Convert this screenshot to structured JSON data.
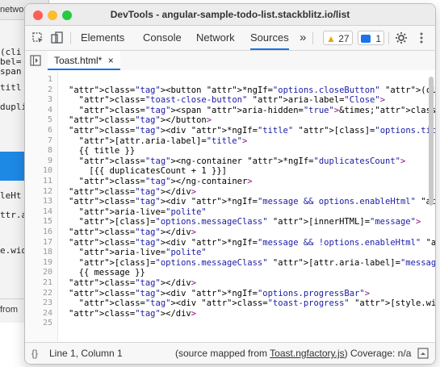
{
  "background_window": {
    "topbar_text": "network",
    "lines": [
      "(cli",
      "bel=",
      "span",
      "titl",
      "dupli",
      "leHt",
      "ttr.a",
      "e.wid"
    ],
    "status_text": "from"
  },
  "window": {
    "title": "DevTools - angular-sample-todo-list.stackblitz.io/list"
  },
  "toolbar": {
    "tabs": [
      "Elements",
      "Console",
      "Network",
      "Sources"
    ],
    "active_tab": "Sources",
    "more_label": "»",
    "warnings_count": "27",
    "messages_count": "1"
  },
  "file_tab": {
    "label": "Toast.html*",
    "close": "×"
  },
  "editor": {
    "line_numbers": [
      "1",
      "2",
      "3",
      "4",
      "5",
      "6",
      "7",
      "8",
      "9",
      "10",
      "11",
      "12",
      "13",
      "14",
      "15",
      "16",
      "17",
      "18",
      "19",
      "20",
      "21",
      "22",
      "23",
      "24",
      "25"
    ],
    "lines": [
      "",
      "<button *ngIf=\"options.closeButton\" (click)=\"remove()\"",
      "  class=\"toast-close-button\" aria-label=\"Close\">",
      "  <span aria-hidden=\"true\">&times;</span>",
      "</button>",
      "<div *ngIf=\"title\" [class]=\"options.titleClass\"",
      "  [attr.aria-label]=\"title\">",
      "  {{ title }}",
      "  <ng-container *ngIf=\"duplicatesCount\">",
      "    [{{ duplicatesCount + 1 }}]",
      "  </ng-container>",
      "</div>",
      "<div *ngIf=\"message && options.enableHtml\" role=\"alertdialog\"",
      "  aria-live=\"polite\"",
      "  [class]=\"options.messageClass\" [innerHTML]=\"message\">",
      "</div>",
      "<div *ngIf=\"message && !options.enableHtml\" role=\"alertdialog\"",
      "  aria-live=\"polite\"",
      "  [class]=\"options.messageClass\" [attr.aria-label]=\"message\">",
      "  {{ message }}",
      "</div>",
      "<div *ngIf=\"options.progressBar\">",
      "  <div class=\"toast-progress\" [style.width]=\"width + '%'\"></div>",
      "</div>",
      ""
    ]
  },
  "status": {
    "braces": "{}",
    "position": "Line 1, Column 1",
    "mapped_prefix": "(source mapped from ",
    "mapped_file": "Toast.ngfactory.js",
    "mapped_suffix": ") Coverage: n/a"
  },
  "colors": {
    "accent": "#1a73e8",
    "arrow": "#1e88e5"
  }
}
